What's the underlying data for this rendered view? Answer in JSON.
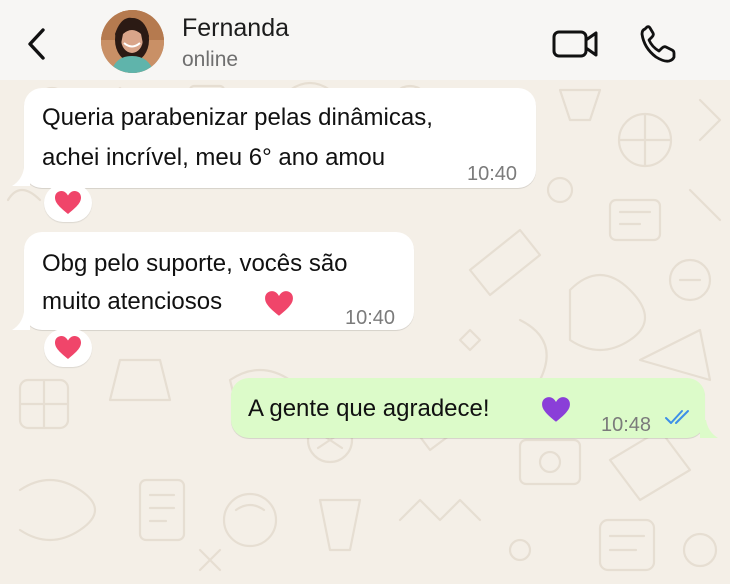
{
  "contact": {
    "name": "Fernanda",
    "status": "online"
  },
  "header": {
    "back_icon": "chevron-left-icon",
    "video_icon": "video-camera-icon",
    "call_icon": "phone-icon"
  },
  "messages": [
    {
      "direction": "incoming",
      "line1": "Queria parabenizar pelas dinâmicas,",
      "line2": "achei incrível, meu 6° ano amou",
      "time": "10:40",
      "reaction": "red-heart",
      "reaction_color": "#f0456a"
    },
    {
      "direction": "incoming",
      "line1": "Obg pelo suporte, vocês são",
      "line2": "muito atenciosos",
      "inline_emoji": "red-heart",
      "time": "10:40",
      "reaction": "red-heart",
      "reaction_color": "#f0456a"
    },
    {
      "direction": "outgoing",
      "line1": "A gente que agradece!",
      "inline_emoji": "purple-heart",
      "inline_emoji_color": "#8a3fd8",
      "time": "10:48",
      "status": "read-double-tick",
      "status_color": "#3d8fe8"
    }
  ],
  "colors": {
    "incoming_bubble": "#ffffff",
    "outgoing_bubble": "#dcfbc9",
    "chat_background": "#f4efe7",
    "header_background": "#f7f6f4"
  }
}
